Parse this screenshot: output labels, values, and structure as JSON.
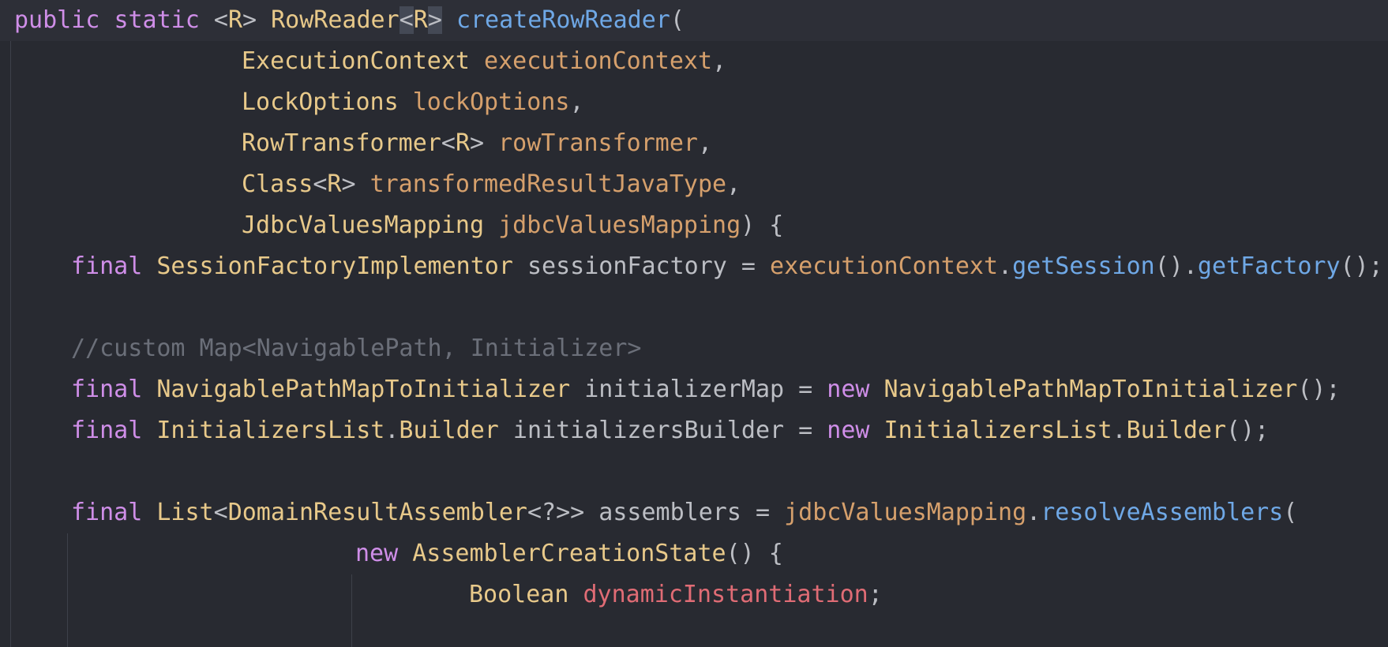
{
  "editor": {
    "theme": {
      "background": "#282a31",
      "current_line": "#2d2f37",
      "keyword": "#cf8ee8",
      "type": "#e8c98a",
      "parameter": "#d6a06c",
      "method": "#6fa8e6",
      "field": "#e06c75",
      "comment": "#6b6f79",
      "plain": "#bcbec4"
    },
    "lines": [
      {
        "tokens": [
          {
            "t": "public",
            "k": "kw"
          },
          {
            "t": " ",
            "k": "pl"
          },
          {
            "t": "static",
            "k": "kw"
          },
          {
            "t": " <",
            "k": "pl"
          },
          {
            "t": "R",
            "k": "ty"
          },
          {
            "t": "> ",
            "k": "pl"
          },
          {
            "t": "RowReader",
            "k": "ty"
          },
          {
            "t": "<",
            "k": "pl",
            "hl": true
          },
          {
            "t": "R",
            "k": "ty"
          },
          {
            "t": ">",
            "k": "pl",
            "hl": true
          },
          {
            "t": " ",
            "k": "pl"
          },
          {
            "t": "createRowReader",
            "k": "me"
          },
          {
            "t": "(",
            "k": "pl"
          }
        ]
      },
      {
        "tokens": [
          {
            "t": "ExecutionContext",
            "k": "ty"
          },
          {
            "t": " ",
            "k": "pl"
          },
          {
            "t": "executionContext",
            "k": "pa"
          },
          {
            "t": ",",
            "k": "pl"
          }
        ]
      },
      {
        "tokens": [
          {
            "t": "LockOptions",
            "k": "ty"
          },
          {
            "t": " ",
            "k": "pl"
          },
          {
            "t": "lockOptions",
            "k": "pa"
          },
          {
            "t": ",",
            "k": "pl"
          }
        ]
      },
      {
        "tokens": [
          {
            "t": "RowTransformer",
            "k": "ty"
          },
          {
            "t": "<",
            "k": "pl"
          },
          {
            "t": "R",
            "k": "ty"
          },
          {
            "t": "> ",
            "k": "pl"
          },
          {
            "t": "rowTransformer",
            "k": "pa"
          },
          {
            "t": ",",
            "k": "pl"
          }
        ]
      },
      {
        "tokens": [
          {
            "t": "Class",
            "k": "ty"
          },
          {
            "t": "<",
            "k": "pl"
          },
          {
            "t": "R",
            "k": "ty"
          },
          {
            "t": "> ",
            "k": "pl"
          },
          {
            "t": "transformedResultJavaType",
            "k": "pa"
          },
          {
            "t": ",",
            "k": "pl"
          }
        ]
      },
      {
        "tokens": [
          {
            "t": "JdbcValuesMapping",
            "k": "ty"
          },
          {
            "t": " ",
            "k": "pl"
          },
          {
            "t": "jdbcValuesMapping",
            "k": "pa"
          },
          {
            "t": ") {",
            "k": "pl"
          }
        ]
      },
      {
        "tokens": [
          {
            "t": "final",
            "k": "kw"
          },
          {
            "t": " ",
            "k": "pl"
          },
          {
            "t": "SessionFactoryImplementor",
            "k": "ty"
          },
          {
            "t": " sessionFactory = ",
            "k": "pl"
          },
          {
            "t": "executionContext",
            "k": "pa"
          },
          {
            "t": ".",
            "k": "pl"
          },
          {
            "t": "getSession",
            "k": "me"
          },
          {
            "t": "().",
            "k": "pl"
          },
          {
            "t": "getFactory",
            "k": "me"
          },
          {
            "t": "();",
            "k": "pl"
          }
        ]
      },
      {
        "tokens": []
      },
      {
        "tokens": [
          {
            "t": "//custom Map<NavigablePath, Initializer>",
            "k": "cm"
          }
        ]
      },
      {
        "tokens": [
          {
            "t": "final",
            "k": "kw"
          },
          {
            "t": " ",
            "k": "pl"
          },
          {
            "t": "NavigablePathMapToInitializer",
            "k": "ty"
          },
          {
            "t": " initializerMap = ",
            "k": "pl"
          },
          {
            "t": "new",
            "k": "kw"
          },
          {
            "t": " ",
            "k": "pl"
          },
          {
            "t": "NavigablePathMapToInitializer",
            "k": "ty"
          },
          {
            "t": "();",
            "k": "pl"
          }
        ]
      },
      {
        "tokens": [
          {
            "t": "final",
            "k": "kw"
          },
          {
            "t": " ",
            "k": "pl"
          },
          {
            "t": "InitializersList",
            "k": "ty"
          },
          {
            "t": ".",
            "k": "pl"
          },
          {
            "t": "Builder",
            "k": "ty"
          },
          {
            "t": " initializersBuilder = ",
            "k": "pl"
          },
          {
            "t": "new",
            "k": "kw"
          },
          {
            "t": " ",
            "k": "pl"
          },
          {
            "t": "InitializersList",
            "k": "ty"
          },
          {
            "t": ".",
            "k": "pl"
          },
          {
            "t": "Builder",
            "k": "ty"
          },
          {
            "t": "();",
            "k": "pl"
          }
        ]
      },
      {
        "tokens": []
      },
      {
        "tokens": [
          {
            "t": "final",
            "k": "kw"
          },
          {
            "t": " ",
            "k": "pl"
          },
          {
            "t": "List",
            "k": "ty"
          },
          {
            "t": "<",
            "k": "pl"
          },
          {
            "t": "DomainResultAssembler",
            "k": "ty"
          },
          {
            "t": "<?>> assemblers = ",
            "k": "pl"
          },
          {
            "t": "jdbcValuesMapping",
            "k": "pa"
          },
          {
            "t": ".",
            "k": "pl"
          },
          {
            "t": "resolveAssemblers",
            "k": "me"
          },
          {
            "t": "(",
            "k": "pl"
          }
        ]
      },
      {
        "tokens": [
          {
            "t": "new",
            "k": "kw"
          },
          {
            "t": " ",
            "k": "pl"
          },
          {
            "t": "AssemblerCreationState",
            "k": "ty"
          },
          {
            "t": "() {",
            "k": "pl"
          }
        ]
      },
      {
        "tokens": [
          {
            "t": "Boolean",
            "k": "ty"
          },
          {
            "t": " ",
            "k": "pl"
          },
          {
            "t": "dynamicInstantiation",
            "k": "fd"
          },
          {
            "t": ";",
            "k": "pl"
          }
        ]
      }
    ]
  }
}
